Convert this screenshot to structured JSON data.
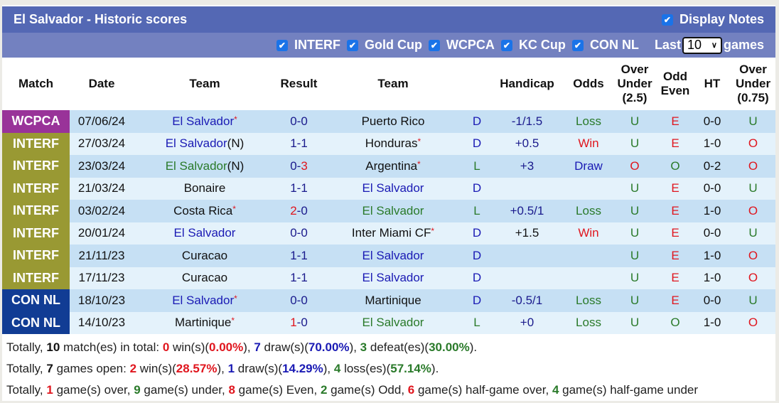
{
  "header": {
    "title": "El Salvador - Historic scores",
    "display_notes_label": "Display Notes",
    "display_notes_checked": true
  },
  "filters": {
    "items": [
      {
        "label": "INTERF",
        "checked": true
      },
      {
        "label": "Gold Cup",
        "checked": true
      },
      {
        "label": "WCPCA",
        "checked": true
      },
      {
        "label": "KC Cup",
        "checked": true
      },
      {
        "label": "CON NL",
        "checked": true
      }
    ],
    "last_label": "Last",
    "last_value": "10",
    "games_label": "games"
  },
  "table": {
    "columns": [
      "Match",
      "Date",
      "Team",
      "Result",
      "Team",
      "",
      "Handicap",
      "Odds",
      "Over Under (2.5)",
      "Odd Even",
      "HT",
      "Over Under (0.75)"
    ],
    "league_colors": {
      "WCPCA": "#993399",
      "INTERF": "#999933",
      "CON NL": "#113c94"
    },
    "rows": [
      {
        "league": "WCPCA",
        "date": "07/06/24",
        "home": "El Salvador",
        "home_star": true,
        "home_suffix": "",
        "home_color": "blue",
        "score_h": "0",
        "score_a": "0",
        "score_h_color": "navy",
        "score_a_color": "navy",
        "away": "Puerto Rico",
        "away_star": false,
        "away_color": "dark",
        "wdl": "D",
        "handicap": "-1/1.5",
        "hc_color": "navy",
        "odds": "Loss",
        "ou": "U",
        "oe": "E",
        "ht": "0-0",
        "ou2": "U"
      },
      {
        "league": "INTERF",
        "date": "27/03/24",
        "home": "El Salvador",
        "home_star": false,
        "home_suffix": "(N)",
        "home_color": "blue",
        "score_h": "1",
        "score_a": "1",
        "score_h_color": "navy",
        "score_a_color": "navy",
        "away": "Honduras",
        "away_star": true,
        "away_color": "dark",
        "wdl": "D",
        "handicap": "+0.5",
        "hc_color": "navy",
        "odds": "Win",
        "ou": "U",
        "oe": "E",
        "ht": "1-0",
        "ou2": "O"
      },
      {
        "league": "INTERF",
        "date": "23/03/24",
        "home": "El Salvador",
        "home_star": false,
        "home_suffix": "(N)",
        "home_color": "green",
        "score_h": "0",
        "score_a": "3",
        "score_h_color": "navy",
        "score_a_color": "red",
        "away": "Argentina",
        "away_star": true,
        "away_color": "dark",
        "wdl": "L",
        "handicap": "+3",
        "hc_color": "navy",
        "odds": "Draw",
        "ou": "O",
        "oe": "O",
        "ht": "0-2",
        "ou2": "O"
      },
      {
        "league": "INTERF",
        "date": "21/03/24",
        "home": "Bonaire",
        "home_star": false,
        "home_suffix": "",
        "home_color": "dark",
        "score_h": "1",
        "score_a": "1",
        "score_h_color": "navy",
        "score_a_color": "navy",
        "away": "El Salvador",
        "away_star": false,
        "away_color": "blue",
        "wdl": "D",
        "handicap": "",
        "hc_color": "navy",
        "odds": "",
        "ou": "U",
        "oe": "E",
        "ht": "0-0",
        "ou2": "U"
      },
      {
        "league": "INTERF",
        "date": "03/02/24",
        "home": "Costa Rica",
        "home_star": true,
        "home_suffix": "",
        "home_color": "dark",
        "score_h": "2",
        "score_a": "0",
        "score_h_color": "red",
        "score_a_color": "navy",
        "away": "El Salvador",
        "away_star": false,
        "away_color": "green",
        "wdl": "L",
        "handicap": "+0.5/1",
        "hc_color": "navy",
        "odds": "Loss",
        "ou": "U",
        "oe": "E",
        "ht": "1-0",
        "ou2": "O"
      },
      {
        "league": "INTERF",
        "date": "20/01/24",
        "home": "El Salvador",
        "home_star": false,
        "home_suffix": "",
        "home_color": "blue",
        "score_h": "0",
        "score_a": "0",
        "score_h_color": "navy",
        "score_a_color": "navy",
        "away": "Inter Miami CF",
        "away_star": true,
        "away_color": "dark",
        "wdl": "D",
        "handicap": "+1.5",
        "hc_color": "dark",
        "odds": "Win",
        "ou": "U",
        "oe": "E",
        "ht": "0-0",
        "ou2": "U"
      },
      {
        "league": "INTERF",
        "date": "21/11/23",
        "home": "Curacao",
        "home_star": false,
        "home_suffix": "",
        "home_color": "dark",
        "score_h": "1",
        "score_a": "1",
        "score_h_color": "navy",
        "score_a_color": "navy",
        "away": "El Salvador",
        "away_star": false,
        "away_color": "blue",
        "wdl": "D",
        "handicap": "",
        "hc_color": "navy",
        "odds": "",
        "ou": "U",
        "oe": "E",
        "ht": "1-0",
        "ou2": "O"
      },
      {
        "league": "INTERF",
        "date": "17/11/23",
        "home": "Curacao",
        "home_star": false,
        "home_suffix": "",
        "home_color": "dark",
        "score_h": "1",
        "score_a": "1",
        "score_h_color": "navy",
        "score_a_color": "navy",
        "away": "El Salvador",
        "away_star": false,
        "away_color": "blue",
        "wdl": "D",
        "handicap": "",
        "hc_color": "navy",
        "odds": "",
        "ou": "U",
        "oe": "E",
        "ht": "1-0",
        "ou2": "O"
      },
      {
        "league": "CON NL",
        "date": "18/10/23",
        "home": "El Salvador",
        "home_star": true,
        "home_suffix": "",
        "home_color": "blue",
        "score_h": "0",
        "score_a": "0",
        "score_h_color": "navy",
        "score_a_color": "navy",
        "away": "Martinique",
        "away_star": false,
        "away_color": "dark",
        "wdl": "D",
        "handicap": "-0.5/1",
        "hc_color": "navy",
        "odds": "Loss",
        "ou": "U",
        "oe": "E",
        "ht": "0-0",
        "ou2": "U"
      },
      {
        "league": "CON NL",
        "date": "14/10/23",
        "home": "Martinique",
        "home_star": true,
        "home_suffix": "",
        "home_color": "dark",
        "score_h": "1",
        "score_a": "0",
        "score_h_color": "red",
        "score_a_color": "navy",
        "away": "El Salvador",
        "away_star": false,
        "away_color": "green",
        "wdl": "L",
        "handicap": "+0",
        "hc_color": "navy",
        "odds": "Loss",
        "ou": "U",
        "oe": "O",
        "ht": "1-0",
        "ou2": "O"
      }
    ]
  },
  "summary": {
    "line1": [
      {
        "t": "Totally, "
      },
      {
        "t": "10",
        "c": "k"
      },
      {
        "t": " match(es) in total: "
      },
      {
        "t": "0",
        "c": "r"
      },
      {
        "t": " win(s)("
      },
      {
        "t": "0.00%",
        "c": "r"
      },
      {
        "t": "), "
      },
      {
        "t": "7",
        "c": "b"
      },
      {
        "t": " draw(s)("
      },
      {
        "t": "70.00%",
        "c": "b"
      },
      {
        "t": "), "
      },
      {
        "t": "3",
        "c": "g"
      },
      {
        "t": " defeat(es)("
      },
      {
        "t": "30.00%",
        "c": "g"
      },
      {
        "t": ")."
      }
    ],
    "line2": [
      {
        "t": "Totally, "
      },
      {
        "t": "7",
        "c": "k"
      },
      {
        "t": " games open: "
      },
      {
        "t": "2",
        "c": "r"
      },
      {
        "t": " win(s)("
      },
      {
        "t": "28.57%",
        "c": "r"
      },
      {
        "t": "), "
      },
      {
        "t": "1",
        "c": "b"
      },
      {
        "t": " draw(s)("
      },
      {
        "t": "14.29%",
        "c": "b"
      },
      {
        "t": "), "
      },
      {
        "t": "4",
        "c": "g"
      },
      {
        "t": " loss(es)("
      },
      {
        "t": "57.14%",
        "c": "g"
      },
      {
        "t": ")."
      }
    ],
    "line3": [
      {
        "t": "Totally, "
      },
      {
        "t": "1",
        "c": "r"
      },
      {
        "t": " game(s) over, "
      },
      {
        "t": "9",
        "c": "g"
      },
      {
        "t": " game(s) under, "
      },
      {
        "t": "8",
        "c": "r"
      },
      {
        "t": " game(s) Even, "
      },
      {
        "t": "2",
        "c": "g"
      },
      {
        "t": " game(s) Odd, "
      },
      {
        "t": "6",
        "c": "r"
      },
      {
        "t": " game(s) half-game over, "
      },
      {
        "t": "4",
        "c": "g"
      },
      {
        "t": " game(s) half-game under"
      }
    ]
  }
}
